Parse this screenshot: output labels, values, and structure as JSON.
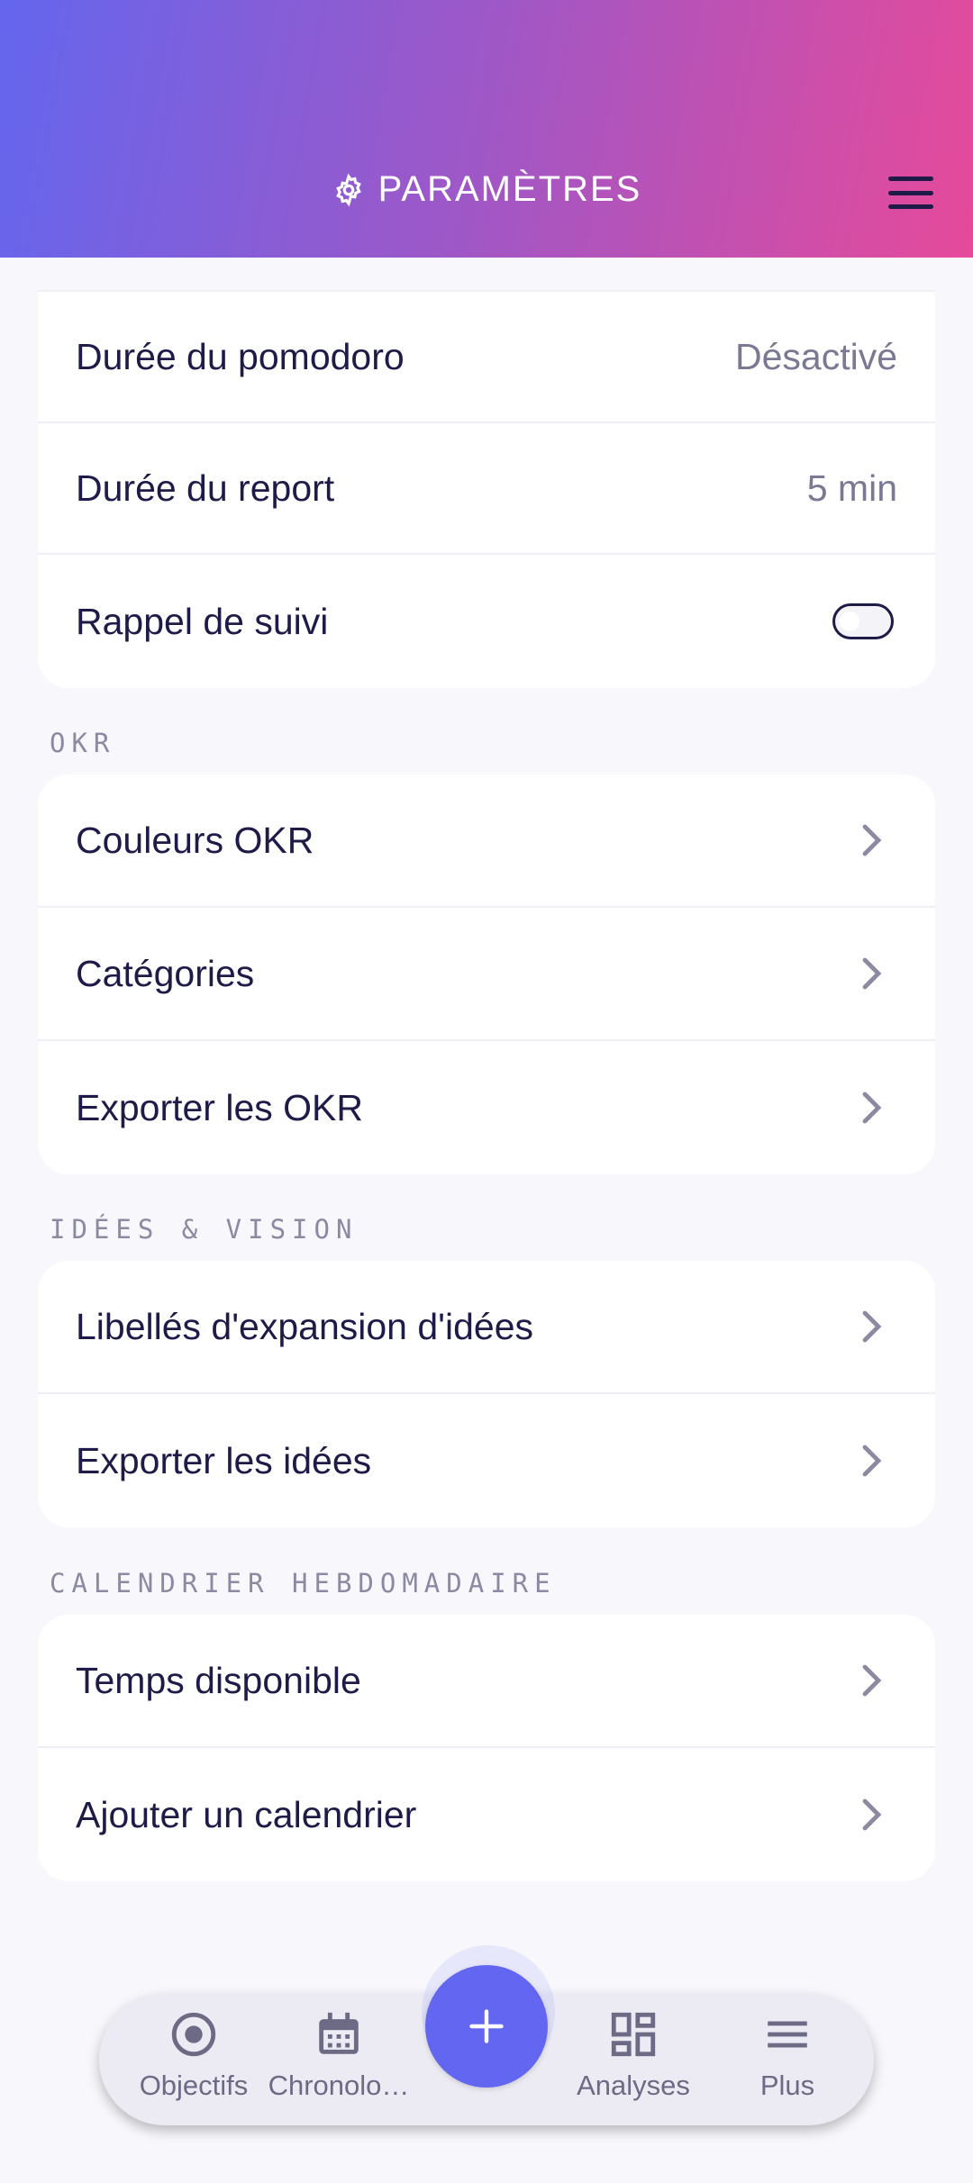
{
  "header": {
    "title": "PARAMÈTRES",
    "title_icon": "gear-icon",
    "menu_icon": "hamburger-menu-icon",
    "gradient": [
      "#6466ee",
      "#e64a9a"
    ]
  },
  "general": {
    "rows": [
      {
        "label": "Durée du pomodoro",
        "value": "Désactivé"
      },
      {
        "label": "Durée du report",
        "value": "5 min"
      },
      {
        "label": "Rappel de suivi",
        "toggle": false
      }
    ]
  },
  "okr": {
    "title": "OKR",
    "items": [
      "Couleurs OKR",
      "Catégories",
      "Exporter les OKR"
    ]
  },
  "ideas": {
    "title": "IDÉES & VISION",
    "items": [
      "Libellés d'expansion d'idées",
      "Exporter les idées"
    ]
  },
  "calendar": {
    "title": "CALENDRIER HEBDOMADAIRE",
    "items": [
      "Temps disponible",
      "Ajouter un calendrier"
    ]
  },
  "nav": {
    "items": [
      {
        "label": "Objectifs",
        "icon": "target-icon"
      },
      {
        "label": "Chronolo…",
        "icon": "calendar-icon"
      },
      {
        "label": "Analyses",
        "icon": "dashboard-icon"
      },
      {
        "label": "Plus",
        "icon": "menu-icon"
      }
    ],
    "fab_icon": "plus-icon",
    "accent": "#6366f1"
  }
}
